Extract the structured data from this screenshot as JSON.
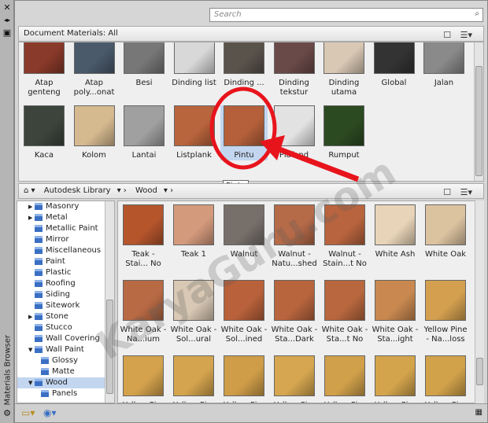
{
  "side_title": "Materials Browser",
  "search": {
    "placeholder": "Search"
  },
  "doc_breadcrumb": "Document Materials: All",
  "doc_materials": [
    {
      "label": "Atap genteng",
      "color": "#8a3a2a"
    },
    {
      "label": "Atap poly...onat",
      "color": "#4a5a6a"
    },
    {
      "label": "Besi",
      "color": "#777"
    },
    {
      "label": "Dinding list",
      "color": "#d8d8d8"
    },
    {
      "label": "Dinding ...",
      "color": "#5a534c"
    },
    {
      "label": "Dinding tekstur",
      "color": "#6a4a48"
    },
    {
      "label": "Dinding utama",
      "color": "#d9c8b4"
    },
    {
      "label": "Global",
      "color": "#333"
    },
    {
      "label": "Jalan",
      "color": "#8a8a8a"
    },
    {
      "label": "Kaca",
      "color": "#3c443c"
    },
    {
      "label": "Kolom",
      "color": "#d5b98f"
    },
    {
      "label": "Lantai",
      "color": "#a0a0a0"
    },
    {
      "label": "Listplank",
      "color": "#b8643c"
    },
    {
      "label": "Pintu",
      "color": "#b5603a"
    },
    {
      "label": "Plafond",
      "color": "#e2e2e2"
    },
    {
      "label": "Rumput",
      "color": "#2c4a22"
    }
  ],
  "tooltip": "Pintu",
  "lib_breadcrumb": {
    "home": "home",
    "library": "Autodesk Library",
    "folder": "Wood"
  },
  "tree": [
    {
      "label": "Masonry",
      "exp": "right",
      "lvl": 0
    },
    {
      "label": "Metal",
      "exp": "right",
      "lvl": 0
    },
    {
      "label": "Metallic Paint",
      "lvl": 0
    },
    {
      "label": "Mirror",
      "lvl": 0
    },
    {
      "label": "Miscellaneous",
      "lvl": 0
    },
    {
      "label": "Paint",
      "lvl": 0
    },
    {
      "label": "Plastic",
      "lvl": 0
    },
    {
      "label": "Roofing",
      "lvl": 0
    },
    {
      "label": "Siding",
      "lvl": 0
    },
    {
      "label": "Sitework",
      "lvl": 0
    },
    {
      "label": "Stone",
      "exp": "right",
      "lvl": 0
    },
    {
      "label": "Stucco",
      "lvl": 0
    },
    {
      "label": "Wall Covering",
      "lvl": 0
    },
    {
      "label": "Wall Paint",
      "exp": "down",
      "lvl": 0
    },
    {
      "label": "Glossy",
      "lvl": 1
    },
    {
      "label": "Matte",
      "lvl": 1
    },
    {
      "label": "Wood",
      "exp": "down",
      "lvl": 0,
      "selected": true
    },
    {
      "label": "Panels",
      "lvl": 1
    }
  ],
  "library_materials": [
    {
      "label": "Teak - Stai... No",
      "color": "#b5552c"
    },
    {
      "label": "Teak 1",
      "color": "#d49a7c"
    },
    {
      "label": "Walnut",
      "color": "#77706a"
    },
    {
      "label": "Walnut - Natu...shed",
      "color": "#b56a48"
    },
    {
      "label": "Walnut - Stain...t No",
      "color": "#b8643e"
    },
    {
      "label": "White Ash",
      "color": "#e8d4b8"
    },
    {
      "label": "White Oak",
      "color": "#dcc3a0"
    },
    {
      "label": "White Oak - Na...ium",
      "color": "#b86a44"
    },
    {
      "label": "White Oak - Sol...ural",
      "color": "#d8c8b4"
    },
    {
      "label": "White Oak - Sol...ined",
      "color": "#b8613a"
    },
    {
      "label": "White Oak - Sta...Dark",
      "color": "#b8653e"
    },
    {
      "label": "White Oak - Sta...t No",
      "color": "#b8673e"
    },
    {
      "label": "White Oak - Sta...ight",
      "color": "#c88850"
    },
    {
      "label": "Yellow Pine - Na...loss",
      "color": "#d4a050"
    },
    {
      "label": "Yellow Pi...",
      "color": "#d4a24c"
    },
    {
      "label": "Yellow Pi...",
      "color": "#d4a44e"
    },
    {
      "label": "Yellow Pi...",
      "color": "#cf9d48"
    },
    {
      "label": "Yellow Pi...",
      "color": "#d6a650"
    },
    {
      "label": "Yellow Pi...",
      "color": "#d0a04a"
    },
    {
      "label": "Yellow Pi...",
      "color": "#d4a44c"
    },
    {
      "label": "Yellow Pi...",
      "color": "#d2a24a"
    }
  ],
  "watermark": "KaryaGuru.com",
  "annotation_color": "#e8141c"
}
